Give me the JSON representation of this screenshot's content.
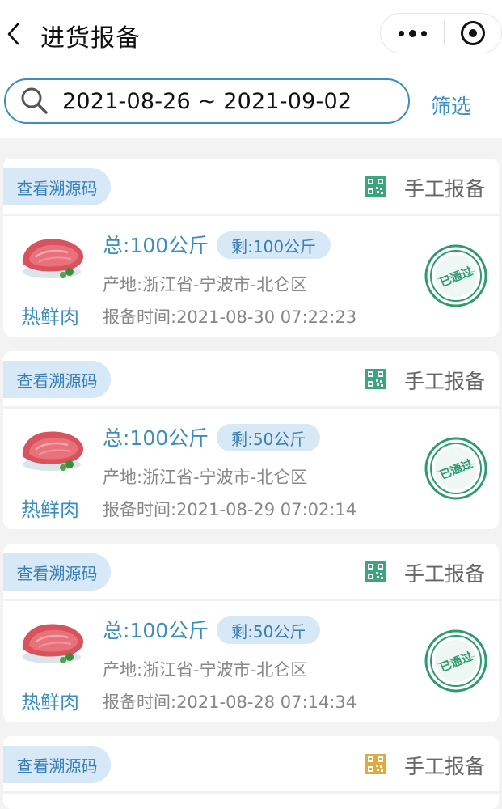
{
  "nav": {
    "title": "进货报备"
  },
  "search": {
    "value": "2021-08-26 ~ 2021-09-02",
    "filter_label": "筛选"
  },
  "colors": {
    "accent": "#3a8fc0",
    "tag_bg": "#d7e9f6",
    "stamp": "#2e9a6e",
    "qr_green": "#3aa67b",
    "qr_yellow": "#e3a93a"
  },
  "cards": [
    {
      "trace_label": "查看溯源码",
      "qr_color": "green",
      "report_type": "手工报备",
      "product_name": "热鲜肉",
      "total": "总:100公斤",
      "remain": "剩:100公斤",
      "origin": "产地:浙江省-宁波市-北仑区",
      "report_time": "报备时间:2021-08-30 07:22:23",
      "status": "已通过"
    },
    {
      "trace_label": "查看溯源码",
      "qr_color": "green",
      "report_type": "手工报备",
      "product_name": "热鲜肉",
      "total": "总:100公斤",
      "remain": "剩:50公斤",
      "origin": "产地:浙江省-宁波市-北仑区",
      "report_time": "报备时间:2021-08-29 07:02:14",
      "status": "已通过"
    },
    {
      "trace_label": "查看溯源码",
      "qr_color": "green",
      "report_type": "手工报备",
      "product_name": "热鲜肉",
      "total": "总:100公斤",
      "remain": "剩:50公斤",
      "origin": "产地:浙江省-宁波市-北仑区",
      "report_time": "报备时间:2021-08-28 07:14:34",
      "status": "已通过"
    },
    {
      "trace_label": "查看溯源码",
      "qr_color": "yellow",
      "report_type": "手工报备"
    }
  ]
}
